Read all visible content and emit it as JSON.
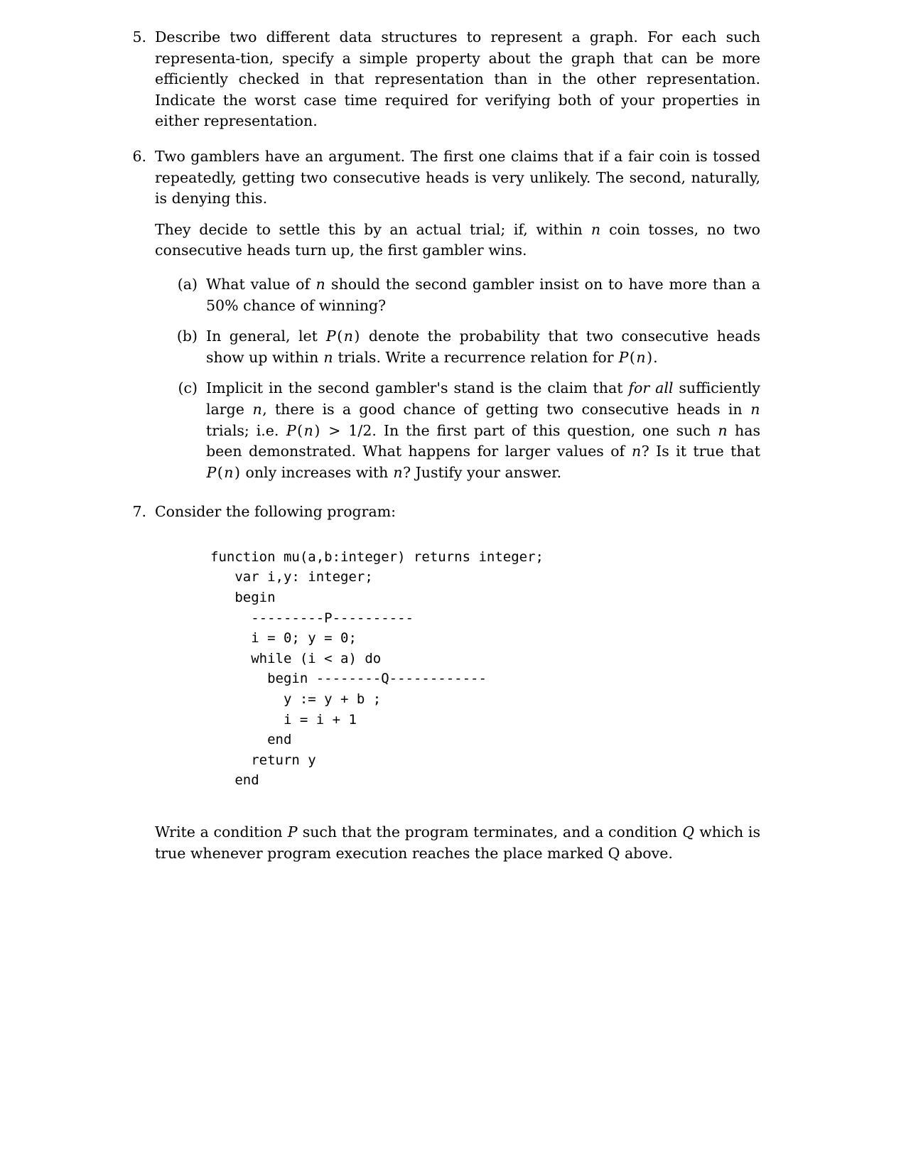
{
  "document": {
    "type": "problem-set-page",
    "items": [
      {
        "number": "5.",
        "paragraphs": [
          "Describe two different data structures to represent a graph. For each such representa-tion, specify a simple property about the graph that can be more efficiently checked in that representation than in the other representation. Indicate the worst case time required for verifying both of your properties in either representation."
        ]
      },
      {
        "number": "6.",
        "paragraphs": [
          "Two gamblers have an argument. The first one claims that if a fair coin is tossed repeatedly, getting two consecutive heads is very unlikely. The second, naturally, is denying this.",
          "They decide to settle this by an actual trial; if, within n coin tosses, no two consecutive heads turn up, the first gambler wins."
        ],
        "sublist": [
          {
            "label": "(a)",
            "text": "What value of n should the second gambler insist on to have more than a 50% chance of winning?"
          },
          {
            "label": "(b)",
            "text": "In general, let P(n) denote the probability that two consecutive heads show up within n trials. Write a recurrence relation for P(n)."
          },
          {
            "label": "(c)",
            "text": "Implicit in the second gambler's stand is the claim that for all sufficiently large n, there is a good chance of getting two consecutive heads in n trials; i.e. P(n) > 1/2. In the first part of this question, one such n has been demonstrated. What happens for larger values of n? Is it true that P(n) only increases with n? Justify your answer."
          }
        ]
      },
      {
        "number": "7.",
        "paragraphs": [
          "Consider the following program:"
        ],
        "code": "function mu(a,b:integer) returns integer;\n   var i,y: integer;\n   begin\n     ---------P----------\n     i = 0; y = 0;\n     while (i < a) do\n       begin --------Q------------\n         y := y + b ;\n         i = i + 1\n       end\n     return y\n   end",
        "closing": "Write a condition P such that the program terminates, and a condition Q which is true whenever program execution reaches the place marked Q above."
      }
    ]
  },
  "item5": {
    "number": "5.",
    "line1_a": "Describe two different data structures to represent a graph. For each such representa-",
    "line2": "tion, specify a simple property about the graph that can be more efficiently checked",
    "line3": "in that representation than in the other representation. Indicate the worst case time",
    "line4": "required for verifying both of your properties in either representation."
  },
  "item6": {
    "number": "6.",
    "p1_line1": "Two gamblers have an argument.  The first one claims that if a fair coin is tossed",
    "p1_line2": "repeatedly, getting two consecutive heads is very unlikely.  The second, naturally, is",
    "p1_line3": "denying this.",
    "p2_line1_a": "They decide to settle this by an actual trial; if, within ",
    "p2_var_n": "n",
    "p2_line1_b": " coin tosses, no two consecutive",
    "p2_line2": "heads turn up, the first gambler wins.",
    "sub_a": {
      "label": "(a)",
      "line1_a": "What value of ",
      "var_n": "n",
      "line1_b": " should the second gambler insist on to have more than a 50%",
      "line2": "chance of winning?"
    },
    "sub_b": {
      "label": "(b)",
      "line1_a": "In general, let ",
      "math_P": "P",
      "math_paren_open": "(",
      "math_n": "n",
      "math_paren_close": ")",
      "line1_b": " denote the probability that two consecutive heads show up",
      "line2_a": "within ",
      "line2_var_n": "n",
      "line2_b": " trials. Write a recurrence relation for ",
      "line2_c": "."
    },
    "sub_c": {
      "label": "(c)",
      "l1_a": "Implicit in the second gambler's stand is the claim that ",
      "l1_em": "for all",
      "l1_b": " sufficiently large ",
      "l1_n": "n",
      "l1_c": ",",
      "l2_a": "there is a good chance of getting two consecutive heads in ",
      "l2_n": "n",
      "l2_b": " trials; i.e. ",
      "l2_gt": ">",
      "l2_frac": "1/2",
      "l2_c": ".",
      "l3": "In  the  first  part  of  this  question,  one  such  ",
      "l3_n": "n",
      "l3_b": "  has  been  demonstrated.   What",
      "l4_a": "happens for larger values of ",
      "l4_n": "n",
      "l4_b": "? Is it true that ",
      "l4_c": " only increases with ",
      "l4_n2": "n",
      "l4_d": "? Justify",
      "l5": "your answer."
    }
  },
  "item7": {
    "number": "7.",
    "intro": "Consider the following program:",
    "code_lines": [
      "function mu(a,b:integer) returns integer;",
      "   var i,y: integer;",
      "   begin",
      "     ---------P----------",
      "     i = 0; y = 0;",
      "     while (i < a) do",
      "       begin --------Q------------",
      "         y := y + b ;",
      "         i = i + 1",
      "       end",
      "     return y",
      "   end"
    ],
    "code_text": "function mu(a,b:integer) returns integer;\n   var i,y: integer;\n   begin\n     ---------P----------\n     i = 0; y = 0;\n     while (i < a) do\n       begin --------Q------------\n         y := y + b ;\n         i = i + 1\n       end\n     return y\n   end",
    "closing_l1_a": "Write a condition ",
    "closing_P": "P",
    "closing_l1_b": " such that the program terminates, and a condition ",
    "closing_Q": "Q",
    "closing_l1_c": " which is",
    "closing_l2": "true whenever program execution reaches the place marked Q above."
  },
  "colors": {
    "page_background": "#ffffff",
    "text": "#000000"
  }
}
